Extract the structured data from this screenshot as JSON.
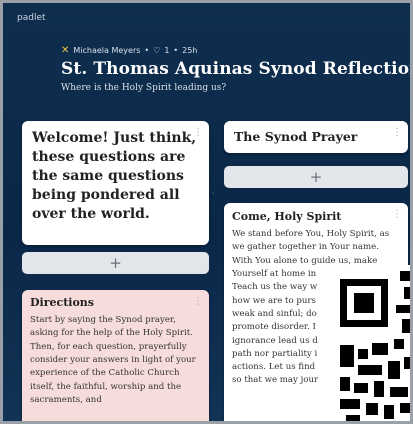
{
  "app": {
    "name": "padlet"
  },
  "author": {
    "name": "Michaela Meyers",
    "likes": "1",
    "age": "25h"
  },
  "board": {
    "title": "St. Thomas Aquinas Synod Reflections",
    "subtitle": "Where is the Holy Spirit leading us?"
  },
  "column1": {
    "welcome": "Welcome! Just think, these questions are the same questions being pondered all over the world.",
    "add_label": "+",
    "directions": {
      "title": "Directions",
      "body": "Start by saying the Synod prayer, asking for the help of the Holy Spirit.  Then, for each question, prayerfully consider your answers in light of your experience of the Catholic Church itself, the faithful, worship and the sacraments, and"
    }
  },
  "column2": {
    "header": "The Synod Prayer",
    "add_label": "+",
    "prayer": {
      "title": "Come, Holy Spirit",
      "lines": [
        "We stand before You, Holy Spirit, as",
        "we gather together in Your name.",
        "With You alone to guide us, make",
        "Yourself at home in",
        "Teach us the way w",
        "how we are to purs",
        "weak and sinful; do",
        "promote disorder. I",
        "ignorance lead us d",
        "path nor partiality i",
        "actions. Let us find",
        "so that we may jour"
      ]
    }
  },
  "icons": {
    "menu": "more-vertical-icon",
    "author": "author-badge-icon"
  },
  "colors": {
    "background": "#0b2748",
    "directions_card": "#f7dcdc",
    "add_button": "#e2e5e9"
  }
}
